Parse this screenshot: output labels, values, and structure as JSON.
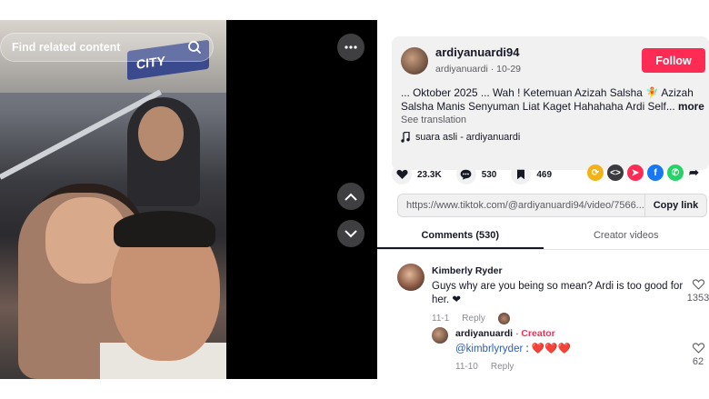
{
  "video": {
    "search_placeholder": "Find related content",
    "search_icon": "search-icon",
    "sign_text": "CITY"
  },
  "post": {
    "username": "ardiyanuardi94",
    "handle": "ardiyanuardi",
    "date": "10-29",
    "follow_label": "Follow",
    "caption": "... Oktober 2025 ... Wah ! Ketemuan Azizah Salsha 🧚 Azizah Salsha Manis Senyuman Liat Kaget Hahahaha Ardi Self...",
    "caption_more": "more",
    "see_translation": "See translation",
    "music": "suara asli - ardiyanuardi"
  },
  "actions": {
    "likes": "23.3K",
    "comments": "530",
    "saves": "469"
  },
  "share_colors": {
    "repost": "#f2b319",
    "embed": "#3a3a3f",
    "send": "#fe2c55",
    "facebook": "#1877f2",
    "whatsapp": "#25d366"
  },
  "link": {
    "url": "https://www.tiktok.com/@ardiyanuardi94/video/7566...",
    "copy_label": "Copy link"
  },
  "tabs": [
    {
      "label": "Comments (530)",
      "active": true
    },
    {
      "label": "Creator videos",
      "active": false
    }
  ],
  "comments": [
    {
      "name": "Kimberly Ryder",
      "text": "Guys why are you being so mean? Ardi is too good for her. ❤",
      "date": "11-1",
      "reply": "Reply",
      "likes": "1353"
    }
  ],
  "reply": {
    "name": "ardiyanuardi",
    "badge": "Creator",
    "mention": "@kimbrlyryder",
    "sep": " : ",
    "hearts": "❤️❤️❤️",
    "date": "11-10",
    "reply": "Reply",
    "likes": "62"
  }
}
